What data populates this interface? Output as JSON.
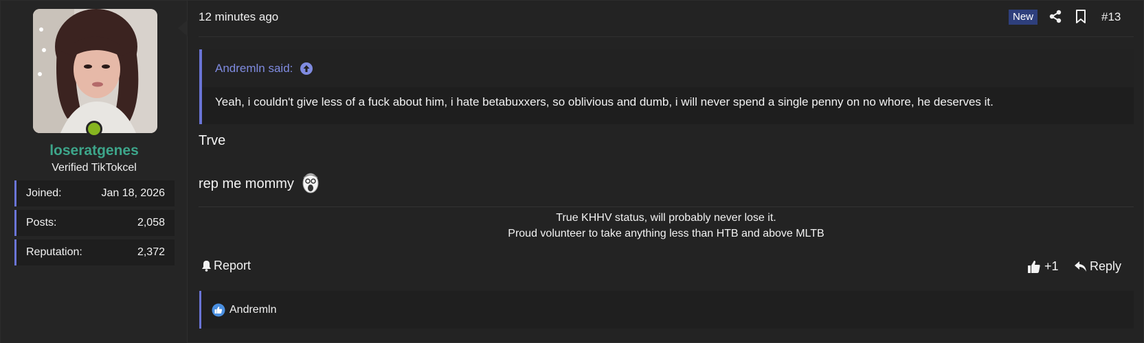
{
  "post": {
    "timestamp": "12 minutes ago",
    "new_badge": "New",
    "post_number": "#13",
    "actions": {
      "share_icon": "share-icon",
      "bookmark_icon": "bookmark-icon"
    }
  },
  "author": {
    "username": "loseratgenes",
    "title": "Verified TikTokcel",
    "online": true,
    "colors": {
      "username": "#3da58a",
      "online_dot": "#86b520"
    },
    "stats": [
      {
        "label": "Joined:",
        "value": "Jan 18, 2026"
      },
      {
        "label": "Posts:",
        "value": "2,058"
      },
      {
        "label": "Reputation:",
        "value": "2,372"
      }
    ]
  },
  "quote": {
    "author_said": "Andremln said:",
    "text": "Yeah, i couldn't give less of a fuck about him, i hate betabuxxers, so oblivious and dumb, i will never spend a single penny on no whore, he deserves it."
  },
  "body": {
    "line1": "Trve",
    "line2": "rep me mommy"
  },
  "signature": {
    "line1": "True KHHV status, will probably never lose it.",
    "line2": "Proud volunteer to take anything less than HTB and above MLTB"
  },
  "footer": {
    "report_label": "Report",
    "like_count": "+1",
    "reply_label": "Reply"
  },
  "reactions": {
    "liked_by": "Andremln"
  },
  "colors": {
    "accent": "#6a74d6",
    "quote_author": "#7f8be0",
    "new_badge_bg": "#2e3f7c"
  }
}
